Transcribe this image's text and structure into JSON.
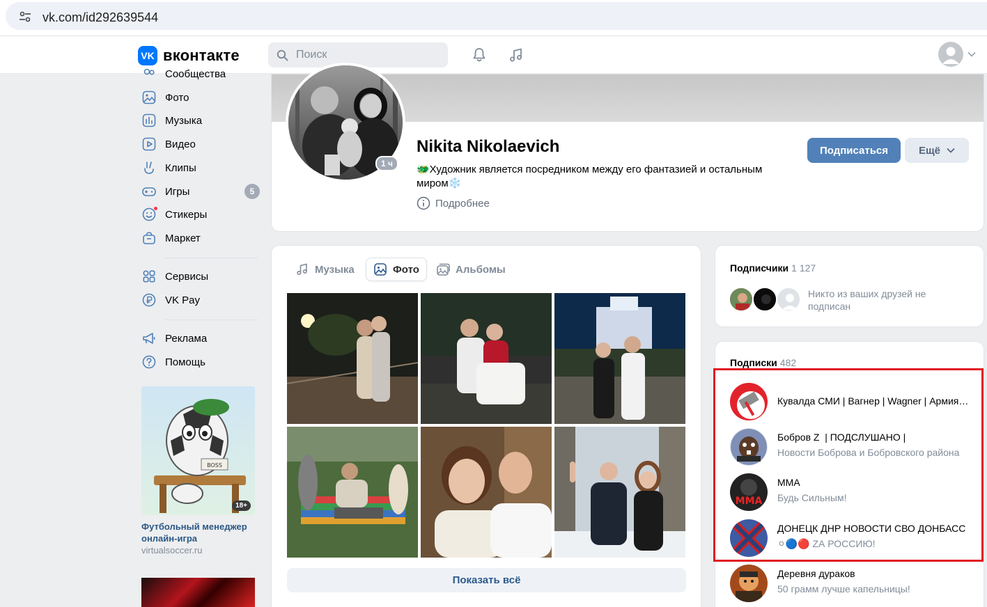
{
  "browser": {
    "url": "vk.com/id292639544"
  },
  "header": {
    "logo_mark": "VK",
    "logo_text": "вконтакте",
    "search_placeholder": "Поиск"
  },
  "leftnav": {
    "items": [
      {
        "label": "Сообщества"
      },
      {
        "label": "Фото"
      },
      {
        "label": "Музыка"
      },
      {
        "label": "Видео"
      },
      {
        "label": "Клипы"
      },
      {
        "label": "Игры",
        "badge": "5"
      },
      {
        "label": "Стикеры"
      },
      {
        "label": "Маркет"
      },
      {
        "label": "Сервисы"
      },
      {
        "label": "VK Pay"
      },
      {
        "label": "Реклама"
      },
      {
        "label": "Помощь"
      }
    ]
  },
  "ad": {
    "age": "18+",
    "title": "Футбольный менеджер онлайн-игра",
    "domain": "virtualsoccer.ru",
    "sign": "BOSS"
  },
  "profile": {
    "name": "Nikita Nikolaevich",
    "status": "🐲Художник является посредником между его фантазией и остальным миром❄️",
    "online": "1 ч",
    "more_info": "Подробнее",
    "subscribe": "Подписаться",
    "more_button": "Ещё"
  },
  "photos": {
    "tabs": [
      {
        "label": "Музыка",
        "active": false
      },
      {
        "label": "Фото",
        "active": true
      },
      {
        "label": "Альбомы",
        "active": false
      }
    ],
    "show_all": "Показать всё"
  },
  "followers": {
    "title": "Подписчики",
    "count": "1 127",
    "note": "Никто из ваших друзей не подписан"
  },
  "subscriptions": {
    "title": "Подписки",
    "count": "482",
    "items": [
      {
        "name": "Кувалда СМИ | Вагнер | Wagner | Армия России",
        "desc": ""
      },
      {
        "name": "Бобров Z ️ | ПОДСЛУШАНО |",
        "desc": "Новости Боброва и Бобровского района"
      },
      {
        "name": "MMA",
        "desc": "Будь Сильным!",
        "logo": "MMA"
      },
      {
        "name": "ДОНЕЦК ДНР НОВОСТИ СВО ДОНБАСС",
        "desc": "⚪🔵🔴 ZА РОССИЮ!"
      },
      {
        "name": "Деревня дураков",
        "desc": "50 грамм лучше капельницы!"
      }
    ]
  },
  "colors": {
    "accent": "#5181b8",
    "link": "#2a5885",
    "highlight_border": "#e01a22",
    "vk_blue": "#0077ff"
  }
}
